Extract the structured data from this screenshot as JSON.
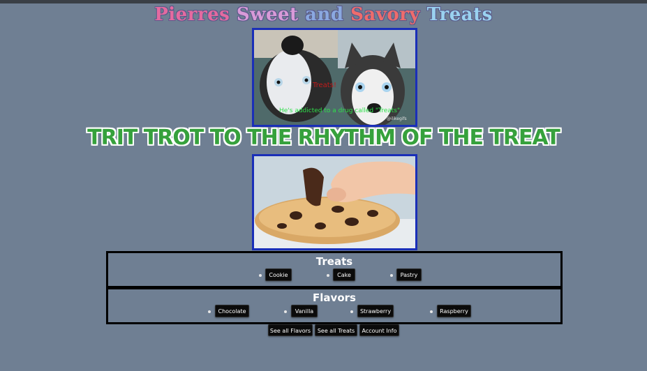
{
  "site": {
    "title_words": [
      "Pierres",
      "Sweet",
      "and",
      "Savory",
      "Treats"
    ]
  },
  "gif": {
    "caption_top": "Treats!",
    "caption_bottom": "He's addicted to a drug called \"Treats\"",
    "watermark": "@ilikegifs"
  },
  "banner": {
    "text": "Trit trot to the rhythm of the treat"
  },
  "treats": {
    "heading": "Treats",
    "items": [
      "Cookie",
      "Cake",
      "Pastry"
    ]
  },
  "flavors": {
    "heading": "Flavors",
    "items": [
      "Chocolate",
      "Vanilla",
      "Strawberry",
      "Raspberry"
    ]
  },
  "nav": {
    "see_all_flavors": "See all Flavors",
    "see_all_treats": "See all Treats",
    "account_info": "Account Info"
  },
  "colors": {
    "background": "#6f7f93",
    "frame_border": "#1a2fb8",
    "banner_green": "#36a13c",
    "button_bg": "#0b0b0b"
  }
}
